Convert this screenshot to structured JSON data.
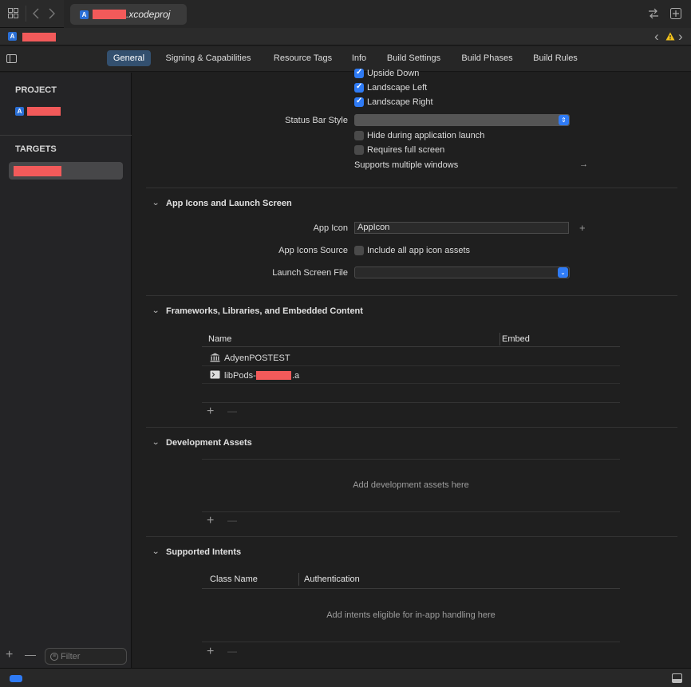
{
  "window": {
    "tab_filename": ".xcodeproj",
    "grid_icon": "grid-icon",
    "back_icon": "chevron-left-icon",
    "forward_icon": "chevron-right-icon",
    "swap_icon": "swap-arrows-icon",
    "add_editor_icon": "plus-square-icon"
  },
  "jumpbar": {
    "warning_icon": "warning-icon",
    "nav_back": "‹",
    "nav_forward": "›"
  },
  "editor_tabs": [
    "General",
    "Signing & Capabilities",
    "Resource Tags",
    "Info",
    "Build Settings",
    "Build Phases",
    "Build Rules"
  ],
  "sidebar": {
    "project_header": "PROJECT",
    "targets_header": "TARGETS",
    "filter_placeholder": "Filter"
  },
  "orientation": {
    "upside_down": "Upside Down",
    "landscape_left": "Landscape Left",
    "landscape_right": "Landscape Right",
    "status_bar_style_label": "Status Bar Style",
    "hide_during_launch": "Hide during application launch",
    "requires_full_screen": "Requires full screen",
    "supports_multiple_windows": "Supports multiple windows",
    "arrow": "→"
  },
  "app_icons": {
    "section_title": "App Icons and Launch Screen",
    "app_icon_label": "App Icon",
    "app_icon_value": "AppIcon",
    "app_icons_source_label": "App Icons Source",
    "include_all": "Include all app icon assets",
    "launch_screen_label": "Launch Screen File",
    "plus": "+"
  },
  "frameworks": {
    "section_title": "Frameworks, Libraries, and Embedded Content",
    "col_name": "Name",
    "col_embed": "Embed",
    "rows": [
      {
        "name": "AdyenPOSTEST",
        "icon": "bank-icon"
      },
      {
        "name_prefix": "libPods-",
        "name_suffix": ".a",
        "icon": "terminal-icon"
      }
    ]
  },
  "dev_assets": {
    "section_title": "Development Assets",
    "placeholder": "Add development assets here"
  },
  "intents": {
    "section_title": "Supported Intents",
    "col_class": "Class Name",
    "col_auth": "Authentication",
    "placeholder": "Add intents eligible for in-app handling here"
  },
  "controls": {
    "plus": "+",
    "minus": "—"
  },
  "colors": {
    "accent": "#2f7bf5",
    "active_tab": "#33506f",
    "redaction": "#f25a5a"
  }
}
